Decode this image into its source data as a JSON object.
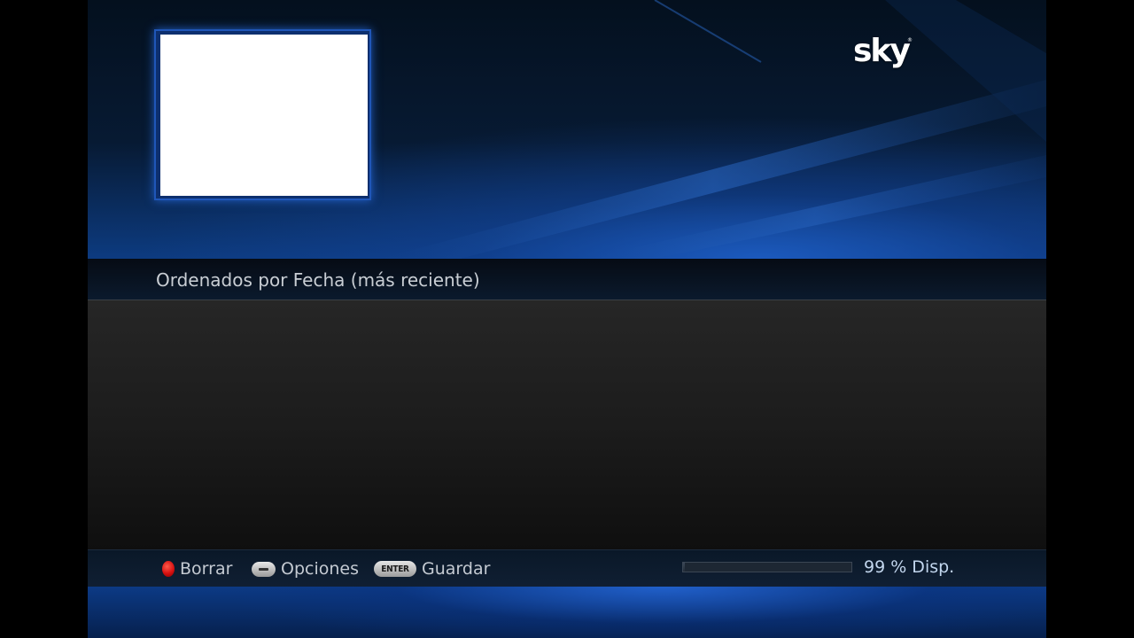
{
  "brand": {
    "logo_text": "sky",
    "logo_reg": "®"
  },
  "recordings": {
    "sort_label": "Ordenados por Fecha (más reciente)",
    "items": []
  },
  "footer": {
    "hints": [
      {
        "key": "red-button",
        "label": "Borrar"
      },
      {
        "key": "minus-button",
        "label": "Opciones"
      },
      {
        "key": "enter-button",
        "key_text": "ENTER",
        "label": "Guardar"
      }
    ],
    "storage": {
      "available_percent": 99,
      "text": "99 % Disp."
    }
  },
  "colors": {
    "accent_blue": "#1f56b8",
    "record_red": "#d61010",
    "text_light": "#c9ced4"
  }
}
